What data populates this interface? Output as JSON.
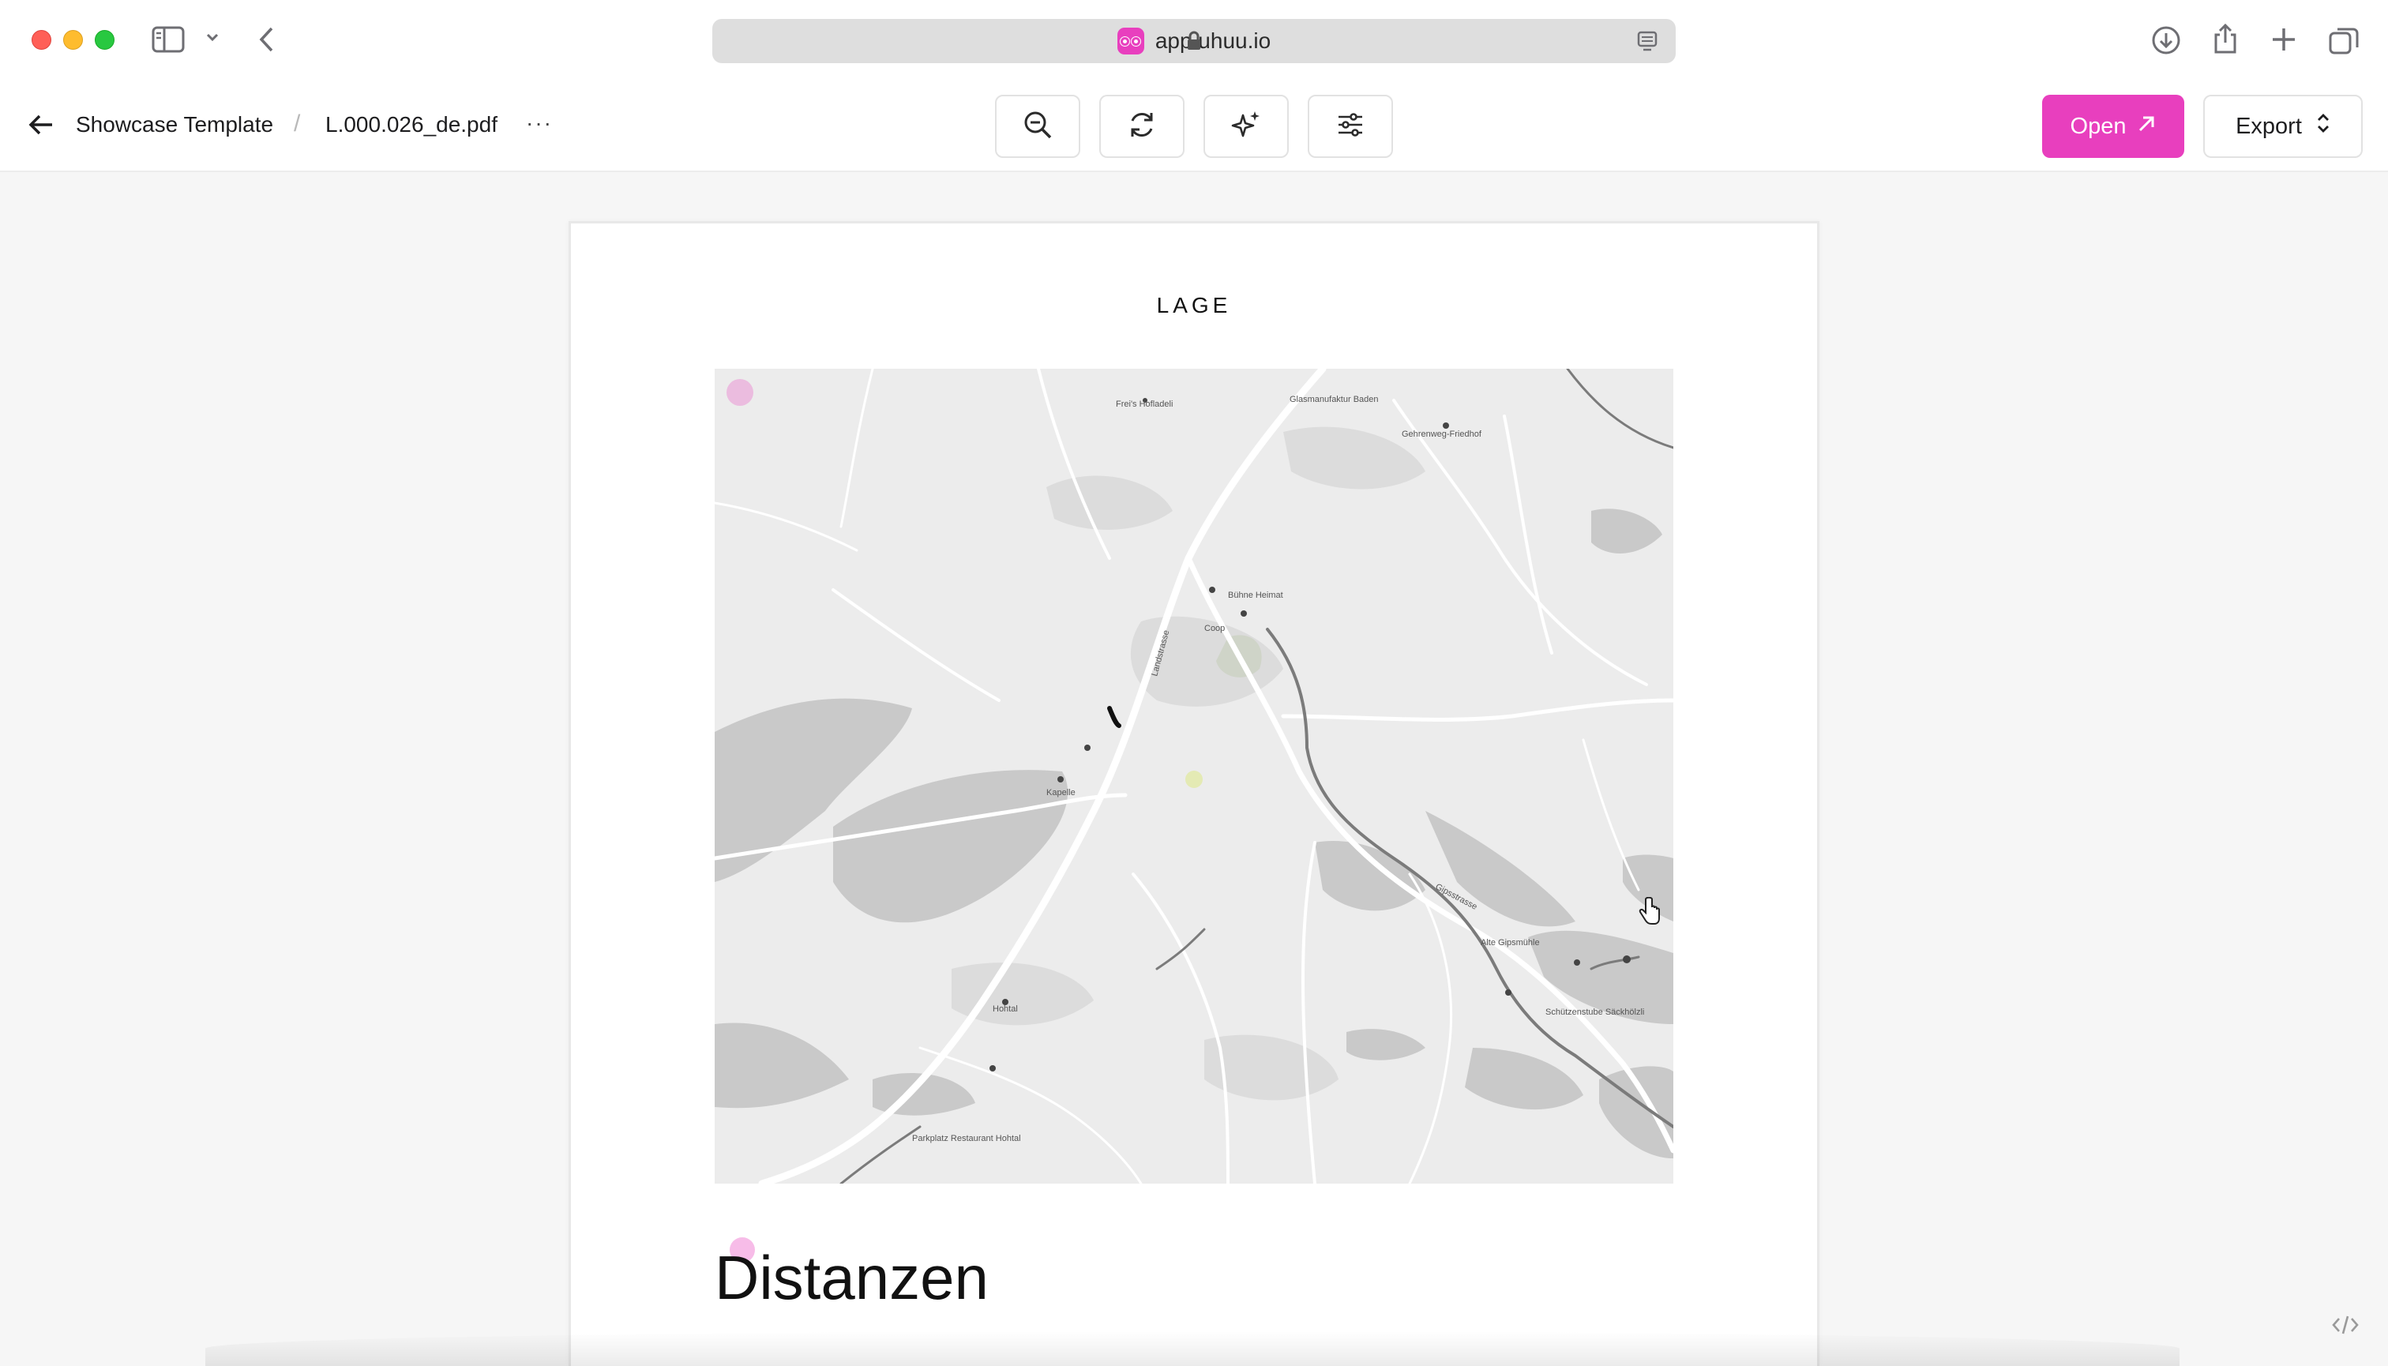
{
  "browser": {
    "url": "app.uhuu.io",
    "icons": {
      "sidebar": "sidebar-icon",
      "chevron": "chevron-down-icon",
      "back": "chevron-left-icon",
      "lock": "lock-icon",
      "reader": "reader-icon",
      "download": "download-icon",
      "share": "share-icon",
      "new_tab": "plus-icon",
      "tabs": "tab-overview-icon"
    }
  },
  "toolbar": {
    "breadcrumb_parent": "Showcase Template",
    "breadcrumb_sep": "/",
    "file_name": "L.000.026_de.pdf",
    "more": "···",
    "open_label": "Open",
    "export_label": "Export",
    "tools": [
      "zoom-out-icon",
      "refresh-icon",
      "sparkles-icon",
      "sliders-icon"
    ]
  },
  "document": {
    "section_title": "LAGE",
    "heading": "Distanzen"
  },
  "map": {
    "labels": [
      "Frei's Hofladeli",
      "Glasmanufaktur Baden",
      "Gehrenweg-Friedhof",
      "Landstrasse",
      "Bühne Heimat",
      "Coop",
      "Kapelle",
      "Hohtal",
      "Parkplatz Restaurant Hohtal",
      "Alte Gipsmühle",
      "Schützenstube Säckhölzli",
      "Gipsstrasse"
    ]
  },
  "colors": {
    "accent": "#e83fbe",
    "map_bg": "#e9e9e9",
    "forest": "#c8c8c8",
    "roads": "#ffffff"
  }
}
